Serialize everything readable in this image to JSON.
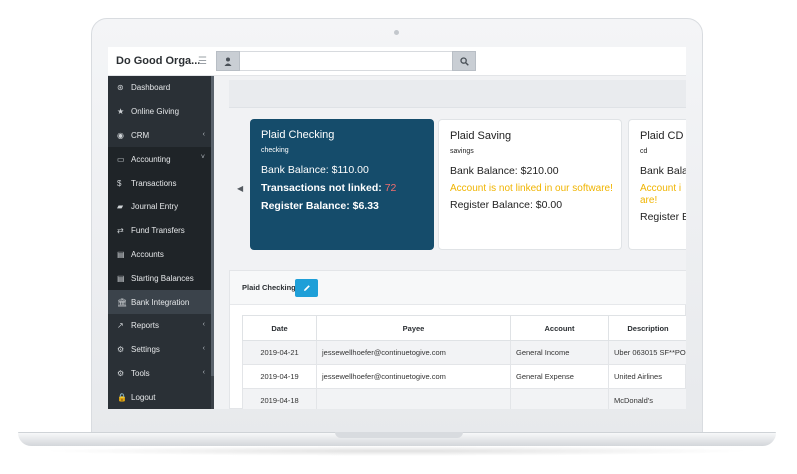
{
  "app": {
    "brand": "Do Good Orga..."
  },
  "search": {
    "value": ""
  },
  "sidebar": {
    "items": [
      {
        "label": "Dashboard",
        "icon": "dashboard-icon",
        "glyph": "⊛"
      },
      {
        "label": "Online Giving",
        "icon": "star-icon",
        "glyph": "★"
      },
      {
        "label": "CRM",
        "icon": "user-circle-icon",
        "glyph": "◉",
        "arrow": "‹"
      },
      {
        "label": "Accounting",
        "icon": "credit-card-icon",
        "glyph": "▭",
        "arrow": "˅"
      },
      {
        "label": "Transactions",
        "icon": "dollar-icon",
        "glyph": "$"
      },
      {
        "label": "Journal Entry",
        "icon": "book-icon",
        "glyph": "▰"
      },
      {
        "label": "Fund Transfers",
        "icon": "exchange-icon",
        "glyph": "⇄"
      },
      {
        "label": "Accounts",
        "icon": "list-icon",
        "glyph": "▤"
      },
      {
        "label": "Starting Balances",
        "icon": "list-icon",
        "glyph": "▤"
      },
      {
        "label": "Bank Integration",
        "icon": "bank-icon",
        "glyph": "🏛"
      },
      {
        "label": "Reports",
        "icon": "line-chart-icon",
        "glyph": "↗",
        "arrow": "‹"
      },
      {
        "label": "Settings",
        "icon": "cogs-icon",
        "glyph": "⚙",
        "arrow": "‹"
      },
      {
        "label": "Tools",
        "icon": "cogs-icon",
        "glyph": "⚙",
        "arrow": "‹"
      },
      {
        "label": "Logout",
        "icon": "lock-icon",
        "glyph": "🔒"
      }
    ]
  },
  "accounts": [
    {
      "title": "Plaid Checking",
      "subtitle": "checking",
      "bank_balance_label": "Bank Balance: ",
      "bank_balance": "$110.00",
      "not_linked_label": "Transactions not linked: ",
      "not_linked_count": "72",
      "register_label": "Register Balance: ",
      "register_balance": "$6.33"
    },
    {
      "title": "Plaid Saving",
      "subtitle": "savings",
      "bank_balance_label": "Bank Balance: ",
      "bank_balance": "$210.00",
      "warning": "Account is not linked in our software!",
      "register_label": "Register Balance: ",
      "register_balance": "$0.00"
    },
    {
      "title": "Plaid CD",
      "subtitle": "cd",
      "bank_balance_label": "Bank Bala",
      "warning": "Account i are!",
      "register_label": "Register B"
    }
  ],
  "panel": {
    "title": "Plaid Checking"
  },
  "table": {
    "headers": [
      "Date",
      "Payee",
      "Account",
      "Description"
    ],
    "rows": [
      [
        "2019-04-21",
        "jessewellhoefer@continuetogive.com",
        "General Income",
        "Uber 063015 SF**PO"
      ],
      [
        "2019-04-19",
        "jessewellhoefer@continuetogive.com",
        "General Expense",
        "United Airlines"
      ],
      [
        "2019-04-18",
        "",
        "",
        "McDonald's"
      ]
    ]
  },
  "colors": {
    "selected_card": "#154c6b",
    "warning": "#f0b400",
    "count_highlight": "#f06d6d",
    "edit_button": "#1e9fd8",
    "sidebar": "#2a3036"
  }
}
